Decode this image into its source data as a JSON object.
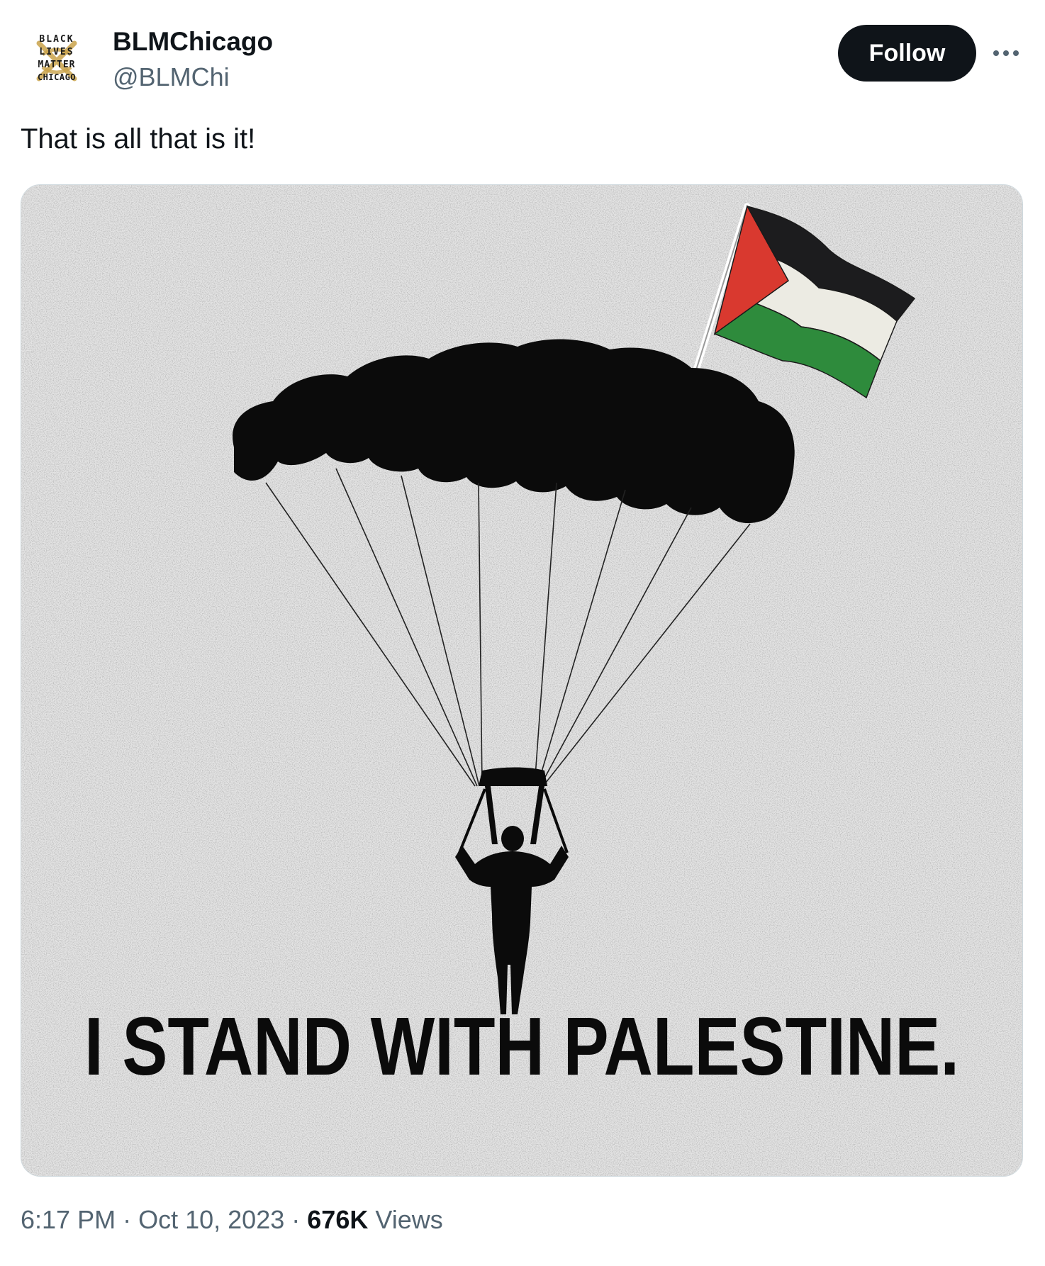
{
  "author": {
    "name": "BLMChicago",
    "handle": "@BLMChi",
    "avatar_text": [
      "BLACK",
      "LIVES",
      "MATTER",
      "CHICAGO"
    ]
  },
  "actions": {
    "follow_label": "Follow",
    "more_icon": "more-horizontal-icon"
  },
  "tweet": {
    "text": "That is all that is it!"
  },
  "media": {
    "caption": "I STAND WITH PALESTINE.",
    "flag_colors": {
      "black": "#1c1c1e",
      "white": "#ecebe3",
      "green": "#2e8b3c",
      "red": "#d9392f"
    }
  },
  "meta": {
    "time": "6:17 PM",
    "separator": "·",
    "date": "Oct 10, 2023",
    "views_count": "676K",
    "views_label": "Views"
  },
  "colors": {
    "text_primary": "#0f1419",
    "text_secondary": "#536471",
    "follow_bg": "#0f1419",
    "border": "#cfd9de"
  }
}
